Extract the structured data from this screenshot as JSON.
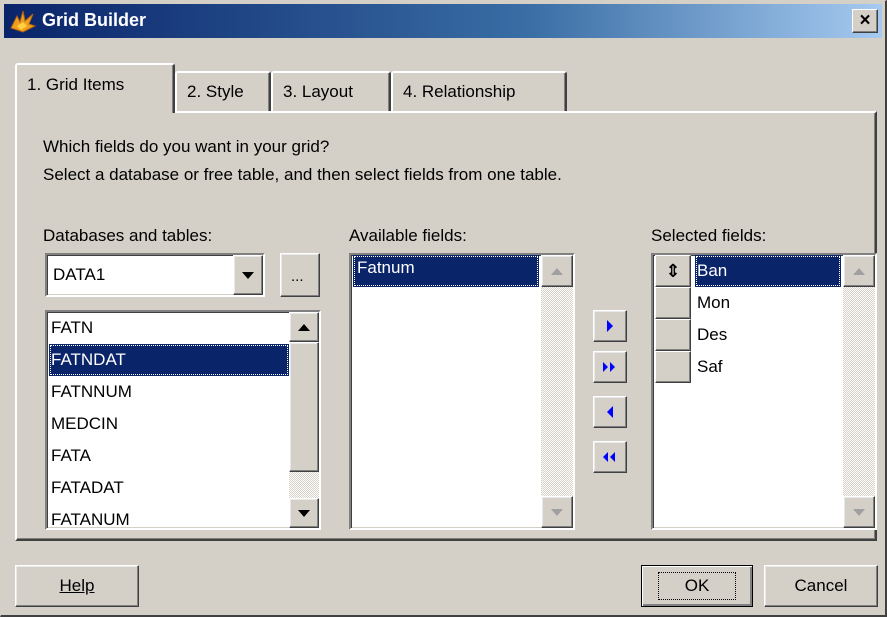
{
  "window": {
    "title": "Grid Builder",
    "close_label": "×"
  },
  "tabs": [
    {
      "label": "1. Grid Items",
      "active": true
    },
    {
      "label": "2. Style",
      "active": false
    },
    {
      "label": "3. Layout",
      "active": false
    },
    {
      "label": "4. Relationship",
      "active": false
    }
  ],
  "instructions": {
    "line1": "Which fields do you want in your grid?",
    "line2": "Select a database or free table, and then select fields from one table."
  },
  "databases": {
    "label": "Databases and tables:",
    "selected_db": "DATA1",
    "browse_label": "...",
    "tables": [
      "FATN",
      "FATNDAT",
      "FATNNUM",
      "MEDCIN",
      "FATA",
      "FATADAT",
      "FATANUM"
    ],
    "selected_table": "FATNDAT"
  },
  "available": {
    "label": "Available fields:",
    "fields": [
      "Fatnum"
    ],
    "selected": "Fatnum"
  },
  "selected": {
    "label": "Selected fields:",
    "fields": [
      "Ban",
      "Mon",
      "Des",
      "Saf"
    ],
    "selected": "Ban",
    "handle_symbol": "⇕"
  },
  "buttons": {
    "help": "Help",
    "ok": "OK",
    "cancel": "Cancel"
  },
  "colors": {
    "selection": "#0a246a",
    "face": "#d4d0c8",
    "move_arrow": "#0000ff"
  }
}
